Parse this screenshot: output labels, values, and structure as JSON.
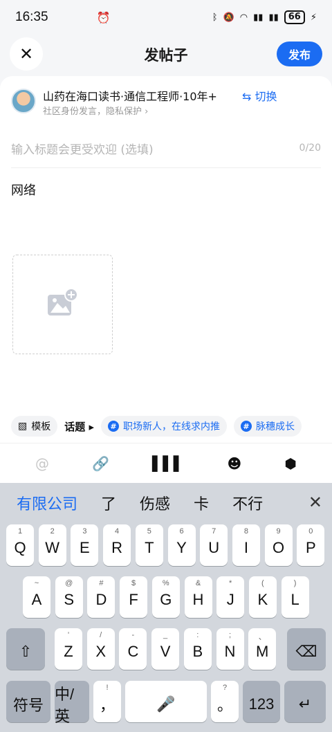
{
  "status": {
    "time": "16:35",
    "battery": "66"
  },
  "header": {
    "title": "发帖子",
    "publish": "发布"
  },
  "identity": {
    "name": "山药在海口读书·通信工程师·10年+",
    "switch": "⇆ 切换",
    "sub": "社区身份发言，隐私保护 ›"
  },
  "post": {
    "title_placeholder": "输入标题会更受欢迎 (选填)",
    "title_count": "0/20",
    "body": "网络"
  },
  "tools": {
    "template": "模板",
    "topic_label": "话题",
    "topics": [
      "职场新人，在线求内推",
      "脉穗成长"
    ]
  },
  "keyboard": {
    "candidates": [
      "有限公司",
      "了",
      "伤感",
      "卡",
      "不行"
    ],
    "row1": [
      [
        "Q",
        "1"
      ],
      [
        "W",
        "2"
      ],
      [
        "E",
        "3"
      ],
      [
        "R",
        "4"
      ],
      [
        "T",
        "5"
      ],
      [
        "Y",
        "6"
      ],
      [
        "U",
        "7"
      ],
      [
        "I",
        "8"
      ],
      [
        "O",
        "9"
      ],
      [
        "P",
        "0"
      ]
    ],
    "row2": [
      [
        "A",
        "~"
      ],
      [
        "S",
        "@"
      ],
      [
        "D",
        "#"
      ],
      [
        "F",
        "$"
      ],
      [
        "G",
        "%"
      ],
      [
        "H",
        "&"
      ],
      [
        "J",
        "*"
      ],
      [
        "K",
        "("
      ],
      [
        "L",
        ")"
      ]
    ],
    "row3": [
      [
        "Z",
        "'"
      ],
      [
        "X",
        "/"
      ],
      [
        "C",
        "-"
      ],
      [
        "V",
        "_"
      ],
      [
        "B",
        ":"
      ],
      [
        "N",
        ";"
      ],
      [
        "M",
        "、"
      ]
    ],
    "symbols": "符号",
    "lang": "中/英",
    "comma": "，",
    "period": "。",
    "num": "123"
  }
}
